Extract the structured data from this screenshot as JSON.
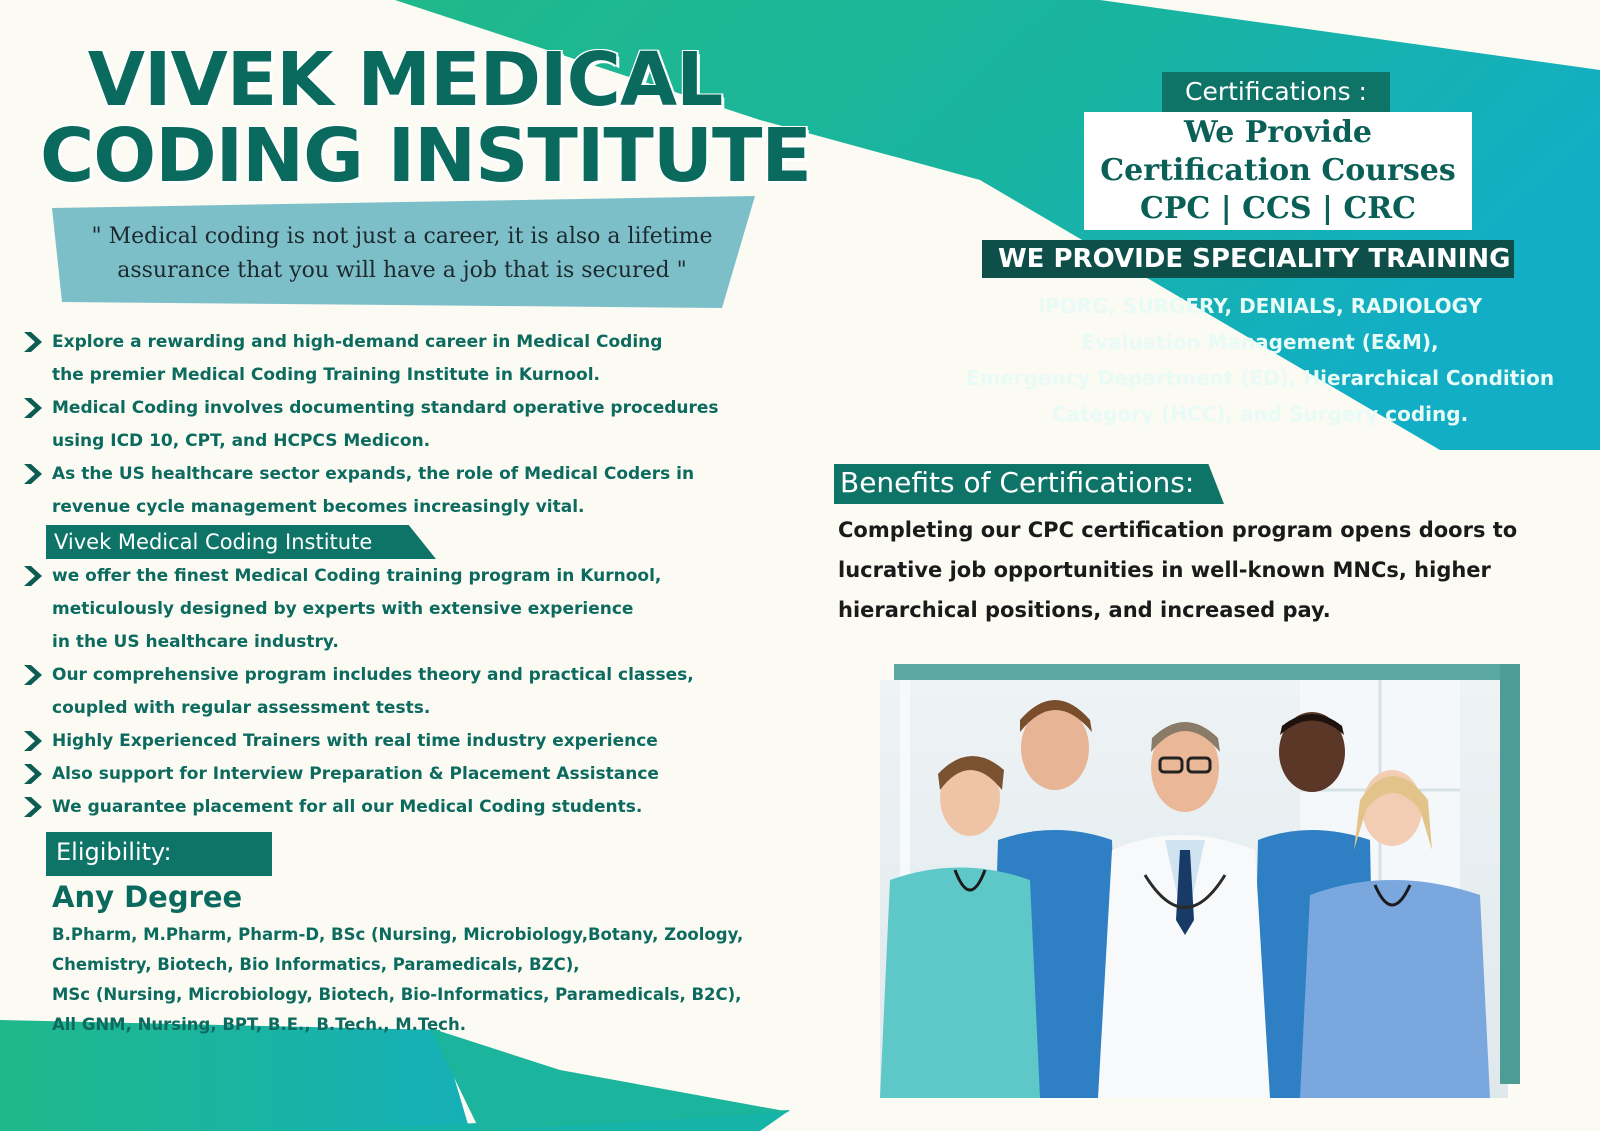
{
  "header": {
    "title_line1": "VIVEK MEDICAL",
    "title_line2": "CODING INSTITUTE",
    "quote_line1": "\" Medical coding is not just a career, it is also a lifetime",
    "quote_line2": "assurance that you will have a job that is secured \""
  },
  "bullets_top": [
    {
      "line1": "Explore a rewarding and high-demand career in Medical Coding",
      "line2": "the premier Medical Coding Training Institute in Kurnool."
    },
    {
      "line1": "Medical Coding involves documenting standard operative procedures",
      "line2": "using ICD 10, CPT, and HCPCS Medicon."
    },
    {
      "line1": "As the US healthcare sector expands, the role of Medical Coders in",
      "line2": "revenue cycle management becomes increasingly vital."
    }
  ],
  "subhead": "Vivek Medical Coding Institute",
  "bullets_bottom": [
    {
      "line1": "we offer the finest Medical Coding training program in Kurnool,",
      "line2": "meticulously designed by experts with extensive experience",
      "line3": "in the US healthcare industry."
    },
    {
      "line1": "Our comprehensive program includes theory and practical classes,",
      "line2": "coupled with regular assessment tests."
    },
    {
      "line1": "Highly Experienced Trainers with real time industry experience"
    },
    {
      "line1": "Also support for Interview Preparation & Placement Assistance"
    },
    {
      "line1": "We guarantee placement for all our Medical Coding students."
    }
  ],
  "eligibility": {
    "label": "Eligibility:",
    "headline": "Any Degree",
    "lines": [
      "B.Pharm, M.Pharm, Pharm-D, BSc (Nursing, Microbiology,Botany, Zoology,",
      "Chemistry, Biotech, Bio Informatics, Paramedicals, BZC),",
      "MSc (Nursing, Microbiology, Biotech, Bio-Informatics, Paramedicals, B2C),",
      "All GNM, Nursing, BPT, B.E., B.Tech., M.Tech."
    ]
  },
  "certifications": {
    "label": "Certifications :",
    "line1": "We Provide",
    "line2": "Certification Courses",
    "line3": "CPC | CCS | CRC"
  },
  "speciality": {
    "heading": "WE PROVIDE SPECIALITY TRAINING",
    "lines": [
      "IPDRG, SURGERY, DENIALS, RADIOLOGY",
      "Evaluation Management (E&M),",
      "Emergency Department (ED), Hierarchical Condition",
      "Category (HCC), and Surgery coding."
    ]
  },
  "benefits": {
    "heading": "Benefits of Certifications:",
    "lines": [
      "Completing our CPC certification program opens doors to",
      "lucrative job opportunities in well-known MNCs, higher",
      "hierarchical positions, and increased pay."
    ]
  },
  "colors": {
    "teal_dark": "#0f7468",
    "teal_text": "#0c6a5f",
    "cyan": "#14b3c2",
    "green": "#1fb888"
  }
}
